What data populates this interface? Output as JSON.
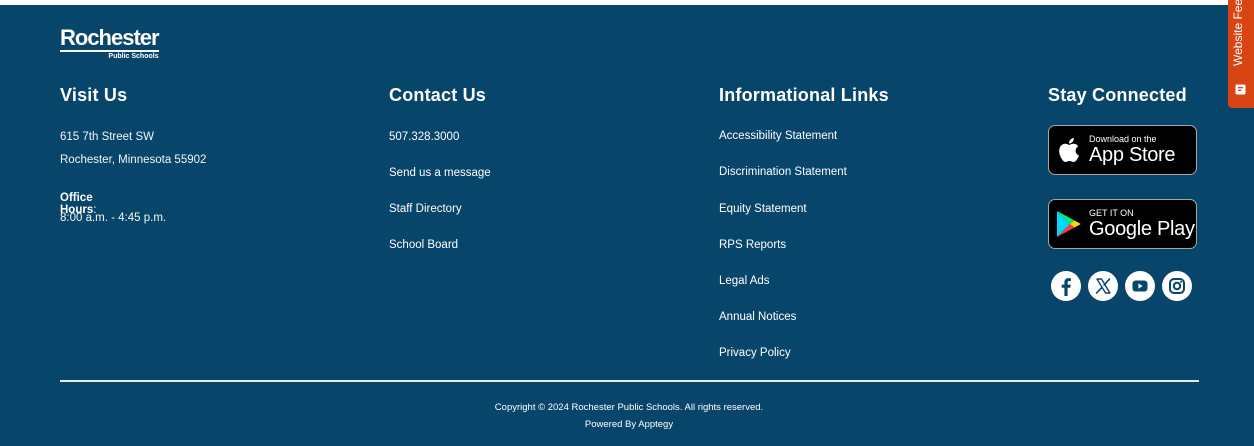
{
  "brand": {
    "logo_main": "Rochester",
    "logo_sub": "Public Schools"
  },
  "visit": {
    "heading": "Visit Us",
    "address_line1": "615 7th Street SW",
    "address_line2": "Rochester, Minnesota 55902",
    "hours_label": "Office Hours",
    "hours_colon": ":",
    "hours": "8:00 a.m. - 4:45 p.m."
  },
  "contact": {
    "heading": "Contact Us",
    "links": [
      "507.328.3000",
      "Send us a message",
      "Staff Directory",
      "School Board"
    ]
  },
  "info": {
    "heading": "Informational Links",
    "links": [
      "Accessibility Statement",
      "Discrimination Statement",
      "Equity Statement",
      "RPS Reports",
      "Legal Ads",
      "Annual Notices",
      "Privacy Policy"
    ]
  },
  "stay": {
    "heading": "Stay Connected",
    "app_store": {
      "line1": "Download on the",
      "line2": "App Store",
      "icon": "apple-icon"
    },
    "google_play": {
      "line1": "GET IT ON",
      "line2": "Google Play",
      "icon": "google-play-icon"
    },
    "social": [
      "facebook-icon",
      "x-icon",
      "youtube-icon",
      "instagram-icon"
    ]
  },
  "footer": {
    "copyright": "Copyright © 2024 Rochester Public Schools. All rights reserved.",
    "powered_by": "Powered By Apptegy"
  },
  "feedback": {
    "label": "Website Feed"
  },
  "colors": {
    "background": "#08456a",
    "feedback_tab": "#d84414",
    "text": "#ffffff"
  }
}
